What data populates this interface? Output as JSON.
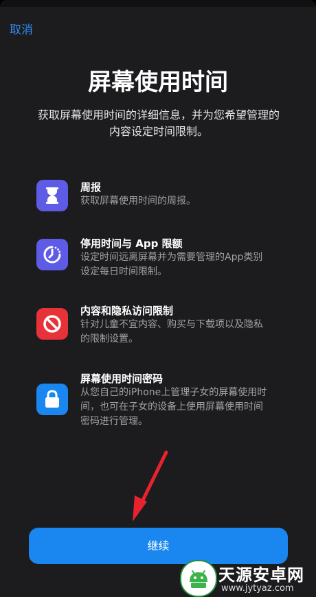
{
  "nav": {
    "cancel_label": "取消"
  },
  "header": {
    "title": "屏幕使用时间",
    "subtitle": "获取屏幕使用时间的详细信息，并为您希望管理的内容设定时间限制。"
  },
  "features": [
    {
      "icon": "hourglass-icon",
      "color": "#5e5ce6",
      "title": "周报",
      "desc": "获取屏幕使用时间的周报。"
    },
    {
      "icon": "downtime-icon",
      "color": "#5e5ce6",
      "title": "停用时间与 App 限额",
      "desc": "设定时间远离屏幕并为需要管理的App类别设定每日时间限制。"
    },
    {
      "icon": "restriction-icon",
      "color": "#e8323a",
      "title": "内容和隐私访问限制",
      "desc": "针对儿童不宜内容、购买与下载项以及隐私的限制设置。"
    },
    {
      "icon": "lock-icon",
      "color": "#1a86f0",
      "title": "屏幕使用时间密码",
      "desc": "从您自己的iPhone上管理子女的屏幕使用时间，也可在子女的设备上使用屏幕使用时间密码进行管理。"
    }
  ],
  "footer": {
    "continue_label": "继续"
  },
  "watermark": {
    "name": "天源安卓网",
    "url": "www.jytyaz.com"
  },
  "colors": {
    "accent": "#1a86f0",
    "annotation_arrow": "#e8232e"
  }
}
